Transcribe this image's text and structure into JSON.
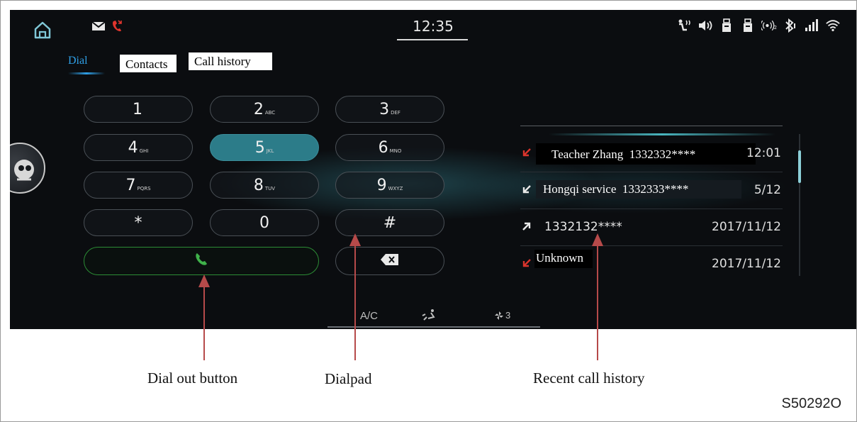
{
  "status_bar": {
    "time": "12:35"
  },
  "tabs": {
    "dial": "Dial",
    "contacts": "Contacts",
    "call_history": "Call history",
    "active": "Dial"
  },
  "dialpad": {
    "keys": [
      {
        "digit": "1",
        "letters": ""
      },
      {
        "digit": "2",
        "letters": "ABC"
      },
      {
        "digit": "3",
        "letters": "DEF"
      },
      {
        "digit": "4",
        "letters": "GHI"
      },
      {
        "digit": "5",
        "letters": "JKL"
      },
      {
        "digit": "6",
        "letters": "MNO"
      },
      {
        "digit": "7",
        "letters": "PQRS"
      },
      {
        "digit": "8",
        "letters": "TUV"
      },
      {
        "digit": "9",
        "letters": "WXYZ"
      },
      {
        "digit": "*",
        "letters": ""
      },
      {
        "digit": "0",
        "letters": ""
      },
      {
        "digit": "#",
        "letters": ""
      }
    ],
    "highlighted_key": "5"
  },
  "recent_calls": [
    {
      "name": "Teacher Zhang",
      "number": "1332332****",
      "time": "12:01",
      "type": "missed"
    },
    {
      "name": "Hongqi service",
      "number": "1332333****",
      "time": "5/12",
      "type": "incoming"
    },
    {
      "name": "",
      "number": "1332132****",
      "time": "2017/11/12",
      "type": "outgoing"
    },
    {
      "name": "Unknown",
      "number": "",
      "time": "2017/11/12",
      "type": "missed"
    }
  ],
  "climate": {
    "ac_label": "A/C",
    "fan_level": "3"
  },
  "annotations": {
    "dial_out_button": "Dial out button",
    "dialpad": "Dialpad",
    "recent_call_history": "Recent call history"
  },
  "figure_code": "S50292O",
  "colors": {
    "accent_blue": "#2f9fe6",
    "key_active": "#2c7c89",
    "call_green": "#2c8c35",
    "missed_red": "#d8342c",
    "annotation_arrow": "#b64a4a"
  }
}
